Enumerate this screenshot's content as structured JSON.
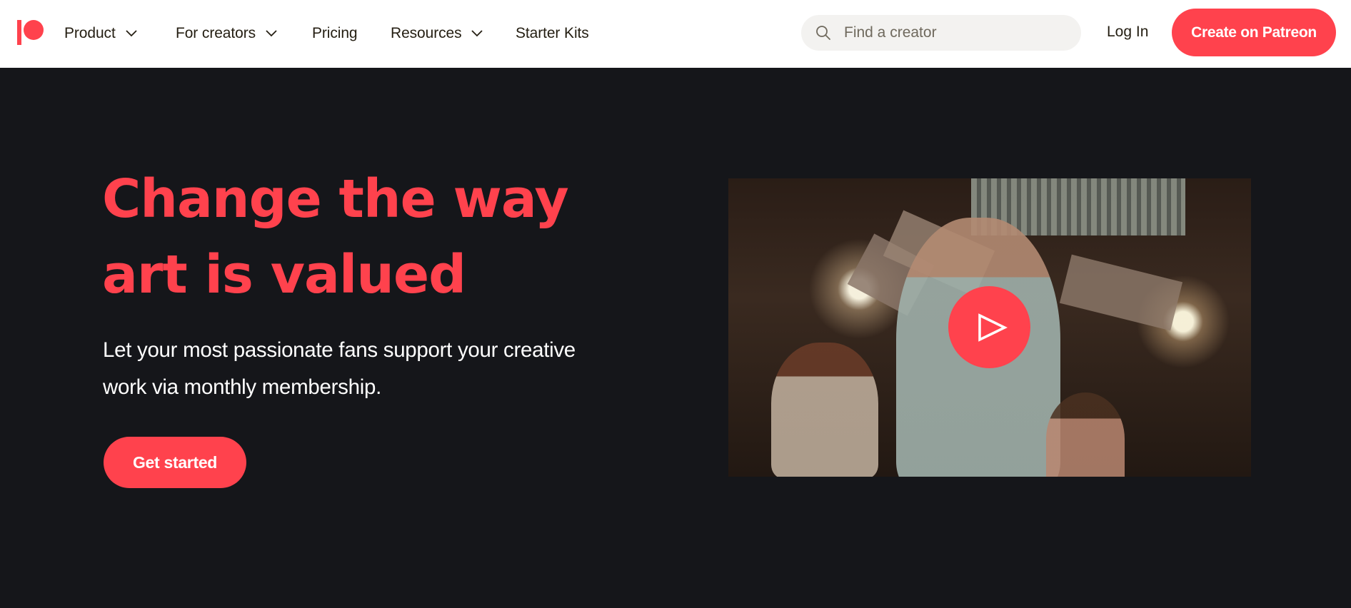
{
  "nav": {
    "logo_alt": "Patreon",
    "items": [
      {
        "label": "Product",
        "has_dropdown": true
      },
      {
        "label": "For creators",
        "has_dropdown": true
      },
      {
        "label": "Pricing",
        "has_dropdown": false
      },
      {
        "label": "Resources",
        "has_dropdown": true
      },
      {
        "label": "Starter Kits",
        "has_dropdown": false
      }
    ],
    "search": {
      "placeholder": "Find a creator",
      "value": "",
      "icon": "search-icon"
    },
    "login_label": "Log In",
    "create_label": "Create on Patreon"
  },
  "hero": {
    "headline_line1": "Change the way",
    "headline_line2": "art is valued",
    "subtitle_line1": "Let your most passionate fans support your creative",
    "subtitle_line2": "work via monthly membership.",
    "cta_label": "Get started",
    "video": {
      "play_icon": "play-icon",
      "alt": "Creator video"
    }
  },
  "colors": {
    "brand": "#ff424d",
    "background": "#15161a",
    "nav_background": "#ffffff",
    "nav_text": "#241e12",
    "search_background": "#f3f2f0"
  }
}
